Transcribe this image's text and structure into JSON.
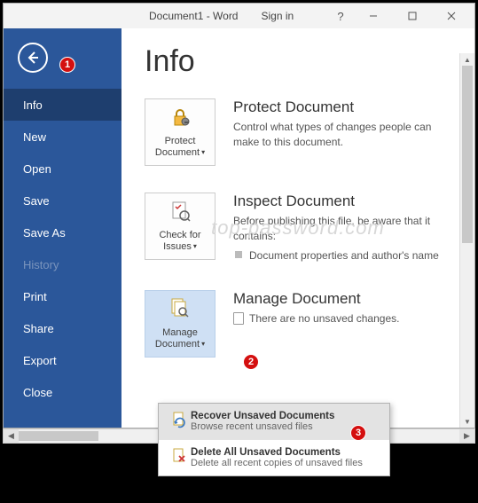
{
  "titlebar": {
    "title": "Document1  -  Word",
    "signin": "Sign in",
    "help": "?"
  },
  "sidebar": {
    "items": [
      {
        "label": "Info",
        "active": true
      },
      {
        "label": "New"
      },
      {
        "label": "Open"
      },
      {
        "label": "Save"
      },
      {
        "label": "Save As"
      },
      {
        "label": "History",
        "disabled": true
      },
      {
        "label": "Print"
      },
      {
        "label": "Share"
      },
      {
        "label": "Export"
      },
      {
        "label": "Close"
      }
    ]
  },
  "page": {
    "title": "Info"
  },
  "sections": {
    "protect": {
      "tile": "Protect Document",
      "heading": "Protect Document",
      "body": "Control what types of changes people can make to this document."
    },
    "inspect": {
      "tile": "Check for Issues",
      "heading": "Inspect Document",
      "body": "Before publishing this file, be aware that it contains:",
      "bullet1": "Document properties and author's name"
    },
    "manage": {
      "tile": "Manage Document",
      "heading": "Manage Document",
      "body": "There are no unsaved changes."
    }
  },
  "dropdown": {
    "recover": {
      "title": "Recover Unsaved Documents",
      "sub": "Browse recent unsaved files"
    },
    "delete": {
      "title": "Delete All Unsaved Documents",
      "sub": "Delete all recent copies of unsaved files"
    }
  },
  "badges": {
    "b1": "1",
    "b2": "2",
    "b3": "3"
  },
  "watermark": "top-password.com"
}
